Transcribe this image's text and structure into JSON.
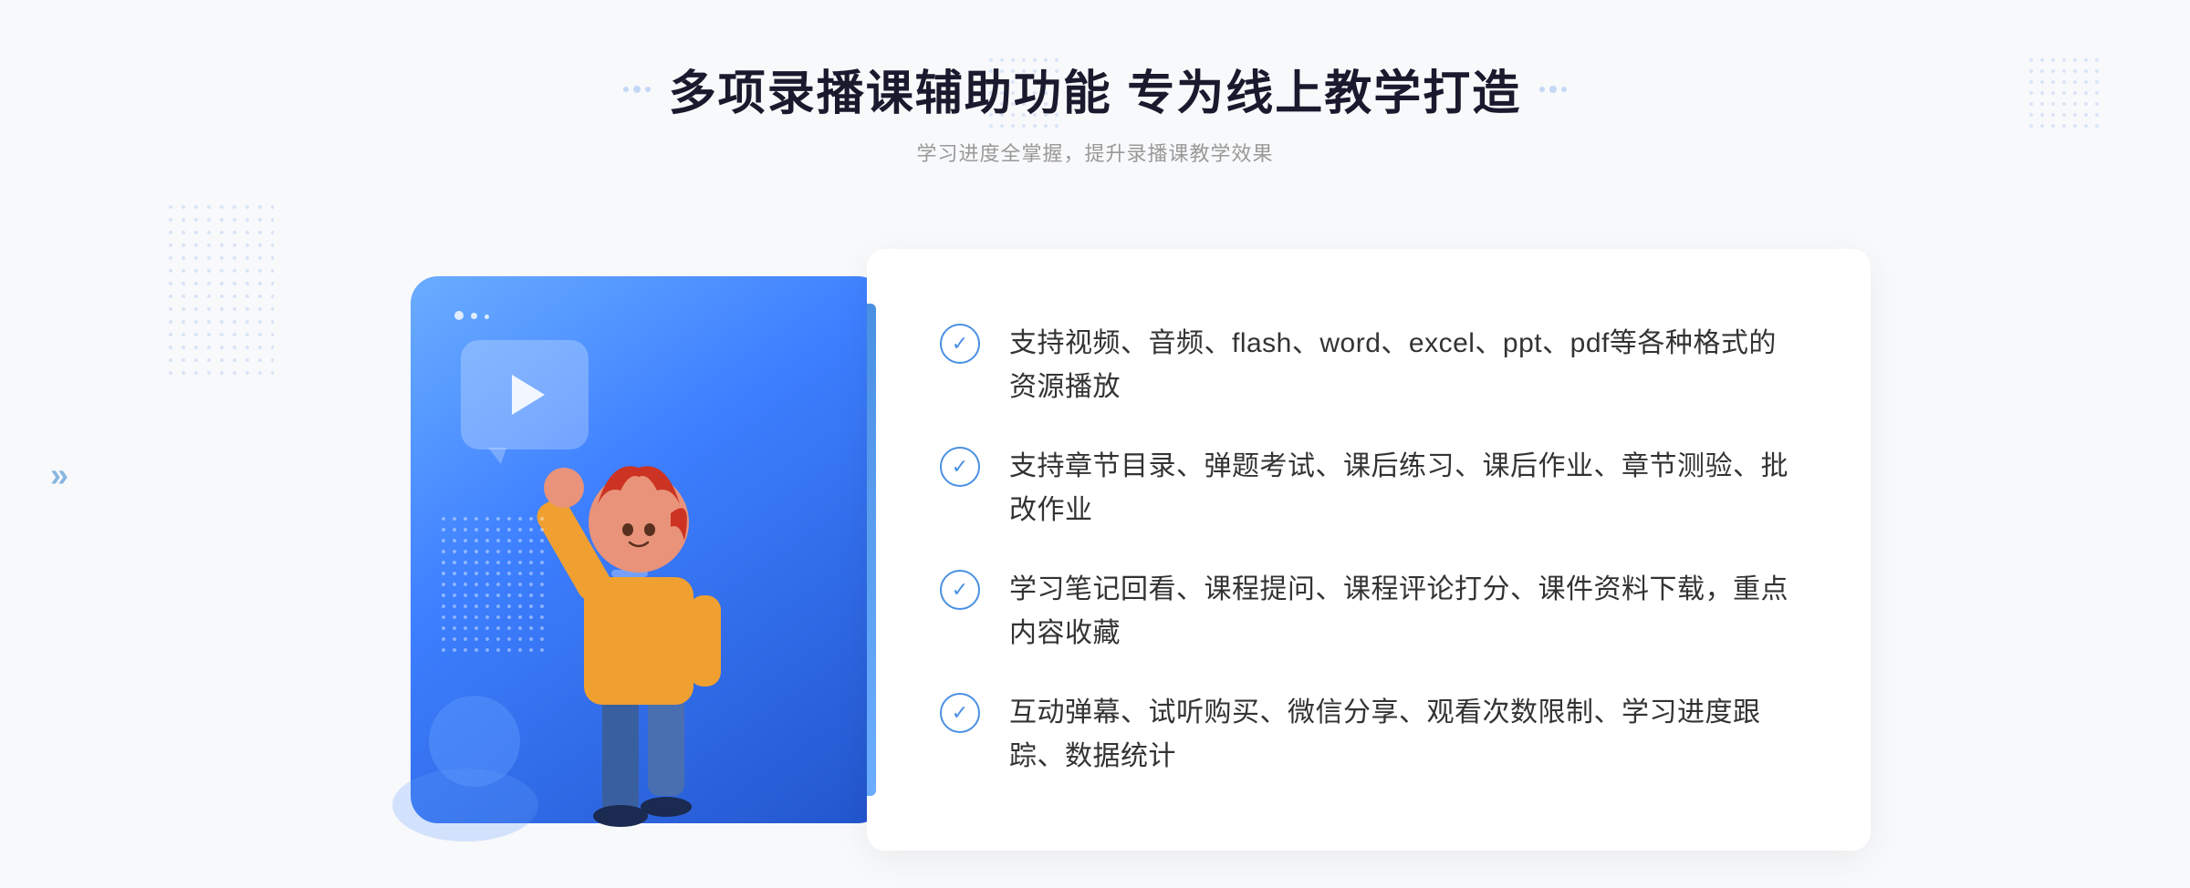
{
  "header": {
    "title": "多项录播课辅助功能 专为线上教学打造",
    "subtitle": "学习进度全掌握，提升录播课教学效果"
  },
  "features": [
    {
      "id": "feature-1",
      "text": "支持视频、音频、flash、word、excel、ppt、pdf等各种格式的资源播放"
    },
    {
      "id": "feature-2",
      "text": "支持章节目录、弹题考试、课后练习、课后作业、章节测验、批改作业"
    },
    {
      "id": "feature-3",
      "text": "学习笔记回看、课程提问、课程评论打分、课件资料下载，重点内容收藏"
    },
    {
      "id": "feature-4",
      "text": "互动弹幕、试听购买、微信分享、观看次数限制、学习进度跟踪、数据统计"
    }
  ],
  "decorations": {
    "arrow_left": "»",
    "check_symbol": "✓"
  }
}
